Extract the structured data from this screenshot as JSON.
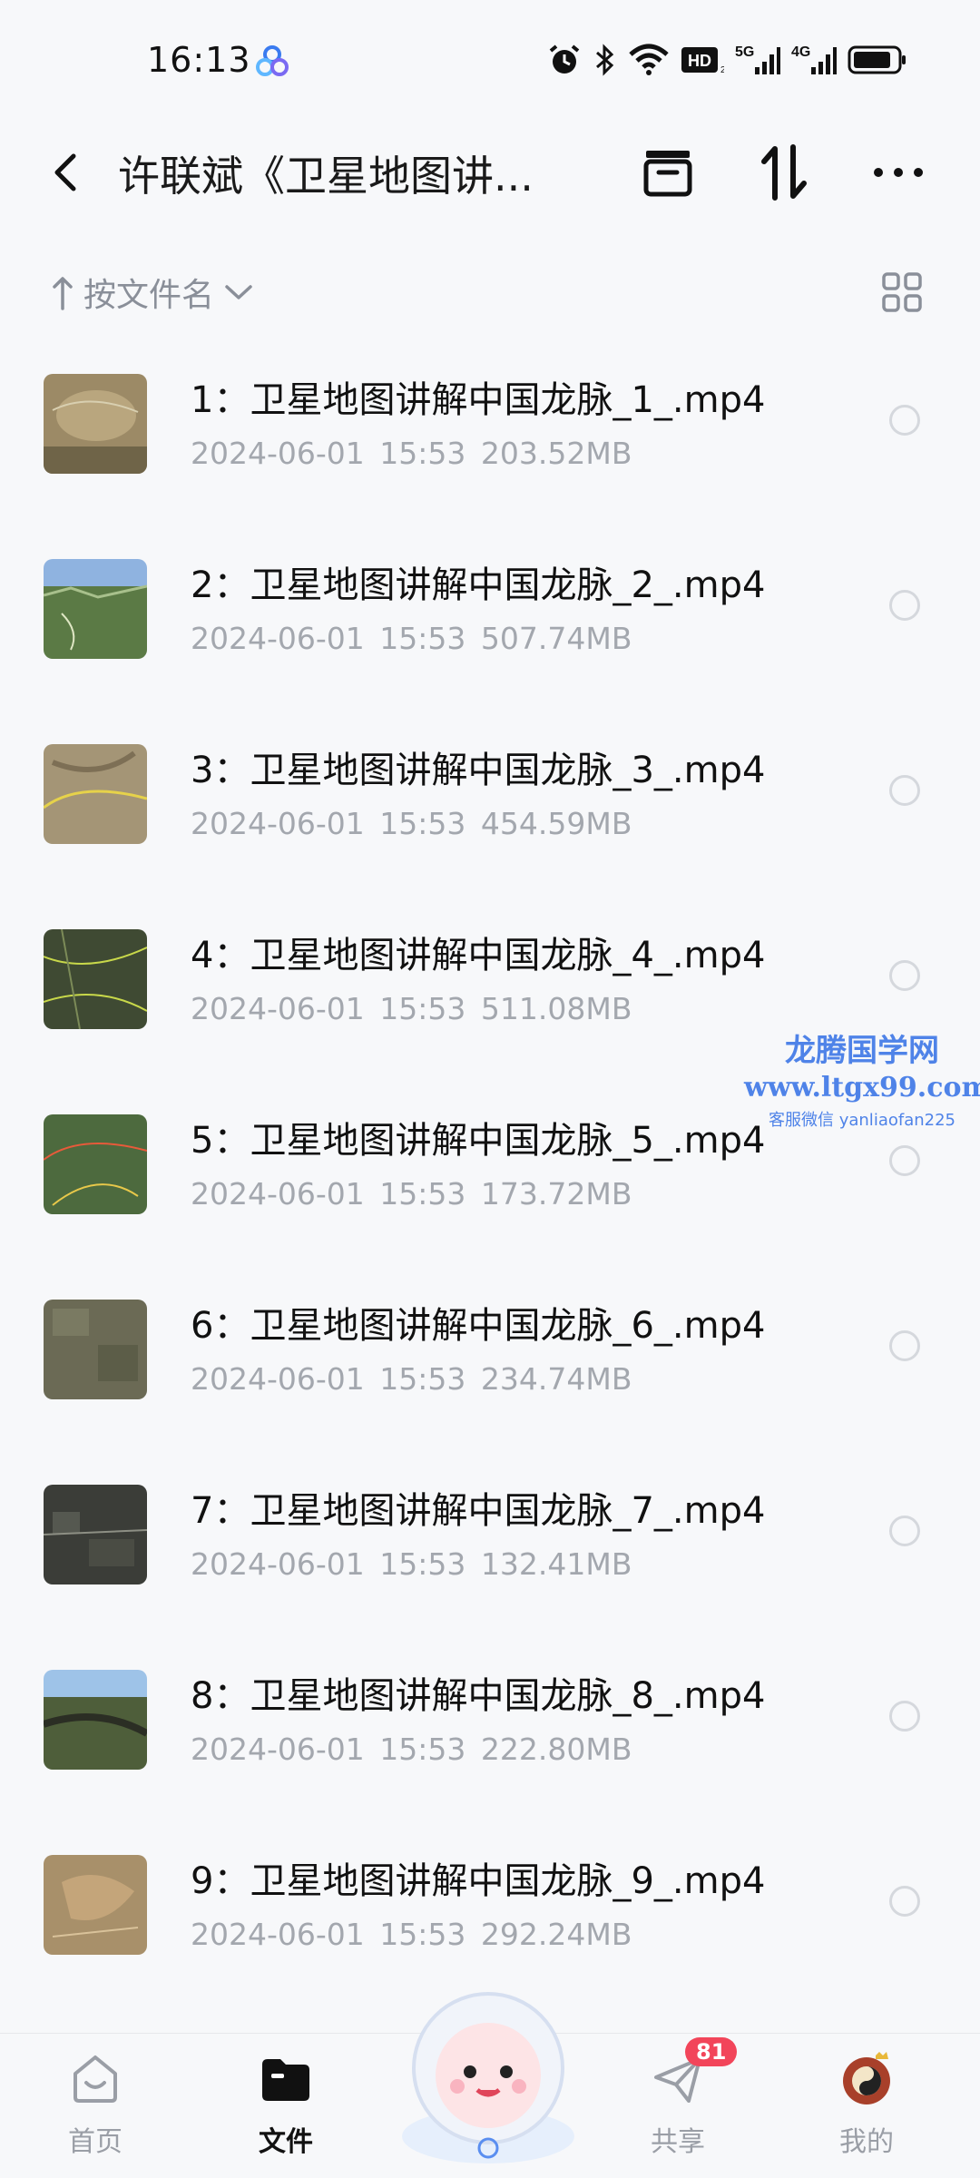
{
  "status_bar": {
    "time": "16:13",
    "icons": [
      "alarm-icon",
      "bluetooth-icon",
      "wifi-icon",
      "hd-icon",
      "signal-5g-icon",
      "signal-4g-icon",
      "battery-icon"
    ],
    "network_5g": "5G",
    "network_4g": "4G",
    "hd": "HD"
  },
  "header": {
    "title": "许联斌《卫星地图讲...",
    "icons": [
      "back-icon",
      "archive-icon",
      "transfer-icon",
      "more-icon"
    ]
  },
  "sort": {
    "label": "按文件名",
    "icons": [
      "arrow-up-icon",
      "chevron-down-icon",
      "grid-view-icon"
    ]
  },
  "files": [
    {
      "name": "1：卫星地图讲解中国龙脉_1_.mp4",
      "date": "2024-06-01",
      "time": "15:53",
      "size": "203.52MB"
    },
    {
      "name": "2：卫星地图讲解中国龙脉_2_.mp4",
      "date": "2024-06-01",
      "time": "15:53",
      "size": "507.74MB"
    },
    {
      "name": "3：卫星地图讲解中国龙脉_3_.mp4",
      "date": "2024-06-01",
      "time": "15:53",
      "size": "454.59MB"
    },
    {
      "name": "4：卫星地图讲解中国龙脉_4_.mp4",
      "date": "2024-06-01",
      "time": "15:53",
      "size": "511.08MB"
    },
    {
      "name": "5：卫星地图讲解中国龙脉_5_.mp4",
      "date": "2024-06-01",
      "time": "15:53",
      "size": "173.72MB"
    },
    {
      "name": "6：卫星地图讲解中国龙脉_6_.mp4",
      "date": "2024-06-01",
      "time": "15:53",
      "size": "234.74MB"
    },
    {
      "name": "7：卫星地图讲解中国龙脉_7_.mp4",
      "date": "2024-06-01",
      "time": "15:53",
      "size": "132.41MB"
    },
    {
      "name": "8：卫星地图讲解中国龙脉_8_.mp4",
      "date": "2024-06-01",
      "time": "15:53",
      "size": "222.80MB"
    },
    {
      "name": "9：卫星地图讲解中国龙脉_9_.mp4",
      "date": "2024-06-01",
      "time": "15:53",
      "size": "292.24MB"
    }
  ],
  "watermark": {
    "title": "龙腾国学网",
    "url": "www.ltgx99.com",
    "contact": "客服微信 yanliaofan225"
  },
  "bottom_nav": {
    "items": [
      {
        "label": "首页",
        "icon": "home-icon"
      },
      {
        "label": "文件",
        "icon": "folder-icon"
      },
      {
        "label": "共享",
        "icon": "send-icon"
      },
      {
        "label": "我的",
        "icon": "avatar-icon"
      }
    ],
    "share_badge": "81",
    "center_icon": "mascot-icon"
  },
  "colors": {
    "accent": "#4f83e8",
    "badge": "#f2455a",
    "meta_text": "#a3a7ae"
  }
}
